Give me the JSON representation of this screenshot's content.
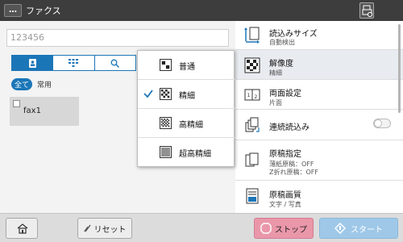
{
  "titlebar": {
    "menu_label": "…",
    "title": "ファクス",
    "status_icon": "fax-status-icon"
  },
  "left": {
    "destination_input": {
      "value": "",
      "placeholder": "123456"
    },
    "tabs": [
      {
        "icon": "address-book-icon",
        "active": true
      },
      {
        "icon": "keypad-icon",
        "active": false
      },
      {
        "icon": "search-icon",
        "active": false
      }
    ],
    "filters": {
      "all": "全て",
      "frequent": "常用"
    },
    "addresses": [
      {
        "name": "fax1"
      }
    ]
  },
  "settings": [
    {
      "title": "読込みサイズ",
      "sub": "自動検出",
      "icon": "scan-size-icon"
    },
    {
      "title": "解像度",
      "sub": "精細",
      "icon": "resolution-icon",
      "selected": true
    },
    {
      "title": "両面設定",
      "sub": "片面",
      "icon": "duplex-icon"
    },
    {
      "title": "連続読込み",
      "icon": "separate-scan-icon",
      "toggle": false
    },
    {
      "title": "原稿指定",
      "sub_lines": [
        "薄紙原稿：OFF",
        "Z折れ原稿：OFF"
      ],
      "icon": "original-type-icon"
    },
    {
      "title": "原稿画質",
      "sub": "文字 / 写真",
      "icon": "image-quality-icon"
    }
  ],
  "resolution_popup": {
    "options": [
      {
        "label": "普通",
        "checked": false
      },
      {
        "label": "精細",
        "checked": true
      },
      {
        "label": "高精細",
        "checked": false
      },
      {
        "label": "超高精細",
        "checked": false
      }
    ]
  },
  "bottom": {
    "reset_label": "リセット",
    "stop_label": "ストップ",
    "start_label": "スタート"
  },
  "colors": {
    "accent": "#1b76b8",
    "stop": "#ea97aa",
    "start": "#9fc8e8",
    "titlebar": "#3d3d3d"
  }
}
